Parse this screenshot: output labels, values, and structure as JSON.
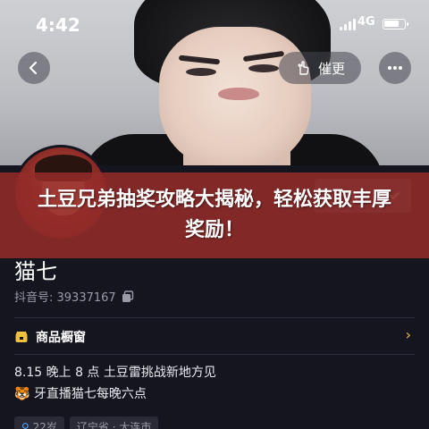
{
  "status_bar": {
    "time": "4:42",
    "network": "4G"
  },
  "header": {
    "follow_label": "催更"
  },
  "profile": {
    "name": "猫七",
    "douyin_id": "抖音号: 39337167",
    "background_button_label": "信"
  },
  "banner": {
    "title": "土豆兄弟抽奖攻略大揭秘，轻松获取丰厚奖励！"
  },
  "shop": {
    "label": "商品橱窗"
  },
  "bio": {
    "line1": "8.15 晚上 8 点 土豆雷挑战新地方见",
    "line2": "牙直播猫七每晚六点"
  },
  "tags": [
    "22岁",
    "辽宁省 · 大连市"
  ],
  "colors": {
    "banner": "#942c2a",
    "background": "#15151f",
    "accent": "#f0c040"
  }
}
